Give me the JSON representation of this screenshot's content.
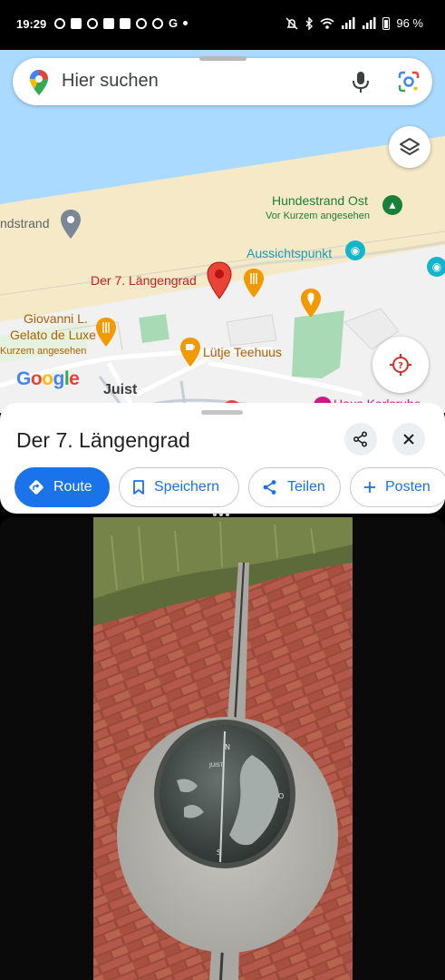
{
  "status_bar": {
    "time": "19:29",
    "battery": "96 %"
  },
  "search": {
    "placeholder": "Hier suchen",
    "icons": [
      "maps-pin-icon",
      "microphone-icon",
      "google-lens-icon"
    ]
  },
  "map": {
    "labels": {
      "hundestrand_ost": "Hundestrand Ost",
      "hundestrand_ost_sub": "Vor Kurzem angesehen",
      "hundestrand_left": "ndstrand",
      "aussichtspunkt": "Aussichtspunkt",
      "selected_place": "Der 7. Längengrad",
      "giovanni_line1": "Giovanni L.",
      "giovanni_line2": "Gelato de Luxe",
      "giovanni_sub": "Kurzem angesehen",
      "luetje": "Lütje Teehuus",
      "town": "Juist",
      "partial_bottom": "Haus Karlsruhe"
    },
    "logo": "Google",
    "colors": {
      "sea": "#aadaff",
      "beach": "#f5e9c8",
      "land": "#f0f0f0",
      "park": "#a8dab5",
      "selected": "#c5221f",
      "food": "#f29900",
      "attraction": "#12b5cb"
    }
  },
  "place": {
    "title": "Der 7. Längengrad",
    "actions": [
      {
        "label": "Route",
        "icon": "directions-icon"
      },
      {
        "label": "Speichern",
        "icon": "bookmark-icon"
      },
      {
        "label": "Teilen",
        "icon": "share-icon"
      },
      {
        "label": "Posten",
        "icon": "plus-icon"
      }
    ]
  }
}
